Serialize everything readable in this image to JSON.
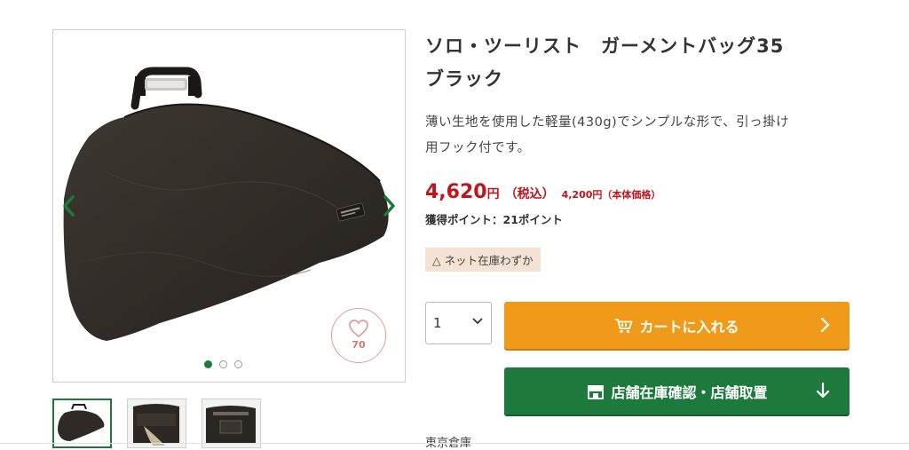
{
  "product": {
    "title_line1": "ソロ・ツーリスト　ガーメントバッグ35",
    "title_line2": "ブラック",
    "description_line1": "薄い生地を使用した軽量(430g)でシンプルな形で、引っ掛け",
    "description_line2": "用フック付です。",
    "price": "4,620",
    "price_unit": "円",
    "tax_label": "（税込）",
    "base_price": "4,200円（本体価格）",
    "points": "獲得ポイント：21ポイント",
    "stock_status": "△ ネット在庫わずか"
  },
  "gallery": {
    "favorite_count": "70",
    "slides": 3,
    "active_slide": 1,
    "thumbnails": [
      "thumbnail-1",
      "thumbnail-2",
      "thumbnail-3"
    ],
    "active_thumbnail": 1
  },
  "purchase": {
    "quantity": "1",
    "cart_button": "カートに入れる",
    "store_button": "店舗在庫確認・店舗取置"
  },
  "footer": {
    "warehouse_label": "東京倉庫"
  },
  "colors": {
    "brand_green": "#1e7a3c",
    "cart_orange": "#f09a1a",
    "price_red": "#c0151d",
    "stock_bg": "#f4e3d2",
    "favorite_pink": "#e39c92"
  },
  "icons": [
    "chevron-left-icon",
    "chevron-right-icon",
    "heart-icon",
    "cart-icon",
    "store-icon",
    "arrow-right-icon",
    "arrow-down-icon",
    "chevron-down-icon"
  ]
}
